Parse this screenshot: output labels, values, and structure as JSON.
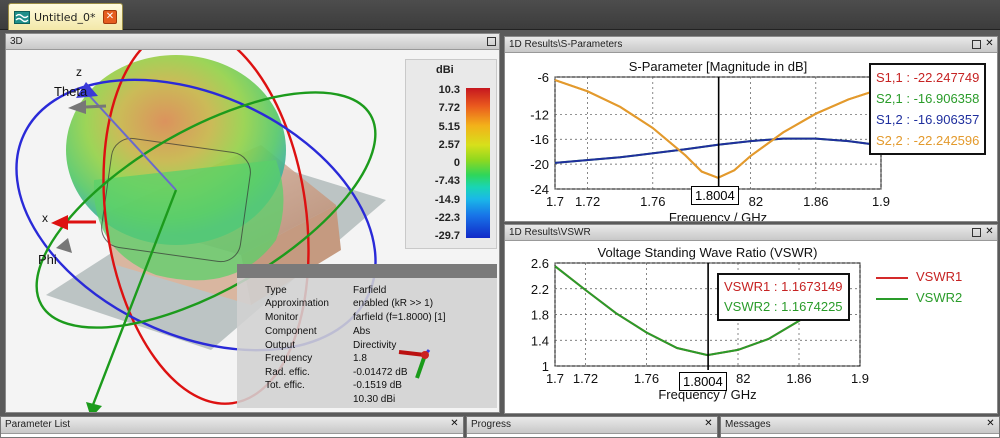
{
  "document_tab": {
    "title": "Untitled_0*",
    "close": "✕"
  },
  "panels": {
    "view3d": {
      "title": "3D"
    },
    "sparams": {
      "title": "1D Results\\S-Parameters"
    },
    "vswr": {
      "title": "1D Results\\VSWR"
    },
    "param_list": {
      "title": "Parameter List"
    },
    "progress": {
      "title": "Progress"
    },
    "messages": {
      "title": "Messages"
    }
  },
  "view3d": {
    "axis_labels": {
      "z": "z",
      "x": "x",
      "theta": "Theta",
      "phi": "Phi"
    },
    "colorbar": {
      "unit": "dBi",
      "ticks": [
        "10.3",
        "7.72",
        "5.15",
        "2.57",
        "0",
        "-7.43",
        "-14.9",
        "-22.3",
        "-29.7"
      ]
    },
    "info": [
      {
        "key": "Type",
        "value": "Farfield"
      },
      {
        "key": "Approximation",
        "value": "enabled (kR >> 1)"
      },
      {
        "key": "Monitor",
        "value": "farfield (f=1.8000) [1]"
      },
      {
        "key": "Component",
        "value": "Abs"
      },
      {
        "key": "Output",
        "value": "Directivity"
      },
      {
        "key": "Frequency",
        "value": "1.8"
      },
      {
        "key": "Rad. effic.",
        "value": "-0.01472 dB"
      },
      {
        "key": "Tot. effic.",
        "value": "-0.1519 dB"
      },
      {
        "key": "",
        "value": "10.30 dBi"
      }
    ]
  },
  "chart_data": [
    {
      "type": "line",
      "title": "S-Parameter [Magnitude in dB]",
      "xlabel": "Frequency / GHz",
      "ylabel": "",
      "xlim": [
        1.7,
        1.9
      ],
      "ylim": [
        -24,
        -6
      ],
      "xticks": [
        "1.7",
        "1.72",
        "1.76",
        "82",
        "1.86",
        "1.9"
      ],
      "yticks": [
        "-6",
        "-12",
        "-16",
        "-20",
        "-24"
      ],
      "marker": {
        "x": 1.8004,
        "label": "1.8004"
      },
      "grid": true,
      "legend_position": "top-right",
      "series": [
        {
          "name": "S1,1",
          "color": "#e39a2d",
          "marker_value": "-22.247749",
          "x": [
            1.7,
            1.72,
            1.74,
            1.76,
            1.78,
            1.79,
            1.8,
            1.81,
            1.82,
            1.84,
            1.86,
            1.88,
            1.9
          ],
          "y": [
            -6.5,
            -8.3,
            -10.8,
            -14.2,
            -18.6,
            -21.2,
            -22.2,
            -21.0,
            -18.7,
            -14.9,
            -11.9,
            -9.6,
            -7.9
          ]
        },
        {
          "name": "S2,1",
          "color": "#2fa32f",
          "marker_value": "-16.906358",
          "x": [
            1.7,
            1.74,
            1.78,
            1.8,
            1.82,
            1.84,
            1.86,
            1.88,
            1.9
          ],
          "y": [
            -19.8,
            -18.9,
            -17.6,
            -16.9,
            -16.3,
            -15.9,
            -15.9,
            -16.3,
            -17.0
          ]
        },
        {
          "name": "S1,2",
          "color": "#1f2f9e",
          "marker_value": "-16.906357",
          "x": [
            1.7,
            1.74,
            1.78,
            1.8,
            1.82,
            1.84,
            1.86,
            1.88,
            1.9
          ],
          "y": [
            -19.8,
            -18.9,
            -17.6,
            -16.9,
            -16.3,
            -15.9,
            -15.9,
            -16.3,
            -17.0
          ]
        },
        {
          "name": "S2,2",
          "color": "#e39a2d",
          "marker_value": "-22.242596",
          "x": [
            1.7,
            1.72,
            1.74,
            1.76,
            1.78,
            1.79,
            1.8,
            1.81,
            1.82,
            1.84,
            1.86,
            1.88,
            1.9
          ],
          "y": [
            -6.5,
            -8.3,
            -10.8,
            -14.2,
            -18.6,
            -21.2,
            -22.2,
            -21.0,
            -18.7,
            -14.9,
            -11.9,
            -9.6,
            -7.9
          ]
        }
      ]
    },
    {
      "type": "line",
      "title": "Voltage Standing Wave Ratio (VSWR)",
      "xlabel": "Frequency / GHz",
      "ylabel": "",
      "xlim": [
        1.7,
        1.9
      ],
      "ylim": [
        1,
        2.6
      ],
      "xticks": [
        "1.7",
        "1.72",
        "1.76",
        "82",
        "1.86",
        "1.9"
      ],
      "yticks": [
        "2.6",
        "2.2",
        "1.8",
        "1.4",
        "1"
      ],
      "marker": {
        "x": 1.8004,
        "label": "1.8004"
      },
      "grid": true,
      "legend_position": "right",
      "series": [
        {
          "name": "VSWR1",
          "color": "#d42a2a",
          "marker_value": "1.1673149",
          "x": [
            1.7,
            1.72,
            1.74,
            1.76,
            1.78,
            1.8,
            1.82,
            1.84,
            1.86,
            1.87
          ],
          "y": [
            2.55,
            2.18,
            1.82,
            1.52,
            1.28,
            1.17,
            1.25,
            1.42,
            1.7,
            1.88
          ]
        },
        {
          "name": "VSWR2",
          "color": "#2a9c2a",
          "marker_value": "1.1674225",
          "x": [
            1.7,
            1.72,
            1.74,
            1.76,
            1.78,
            1.8,
            1.82,
            1.84,
            1.86,
            1.87
          ],
          "y": [
            2.55,
            2.18,
            1.82,
            1.52,
            1.28,
            1.17,
            1.25,
            1.42,
            1.7,
            1.88
          ]
        }
      ]
    }
  ]
}
